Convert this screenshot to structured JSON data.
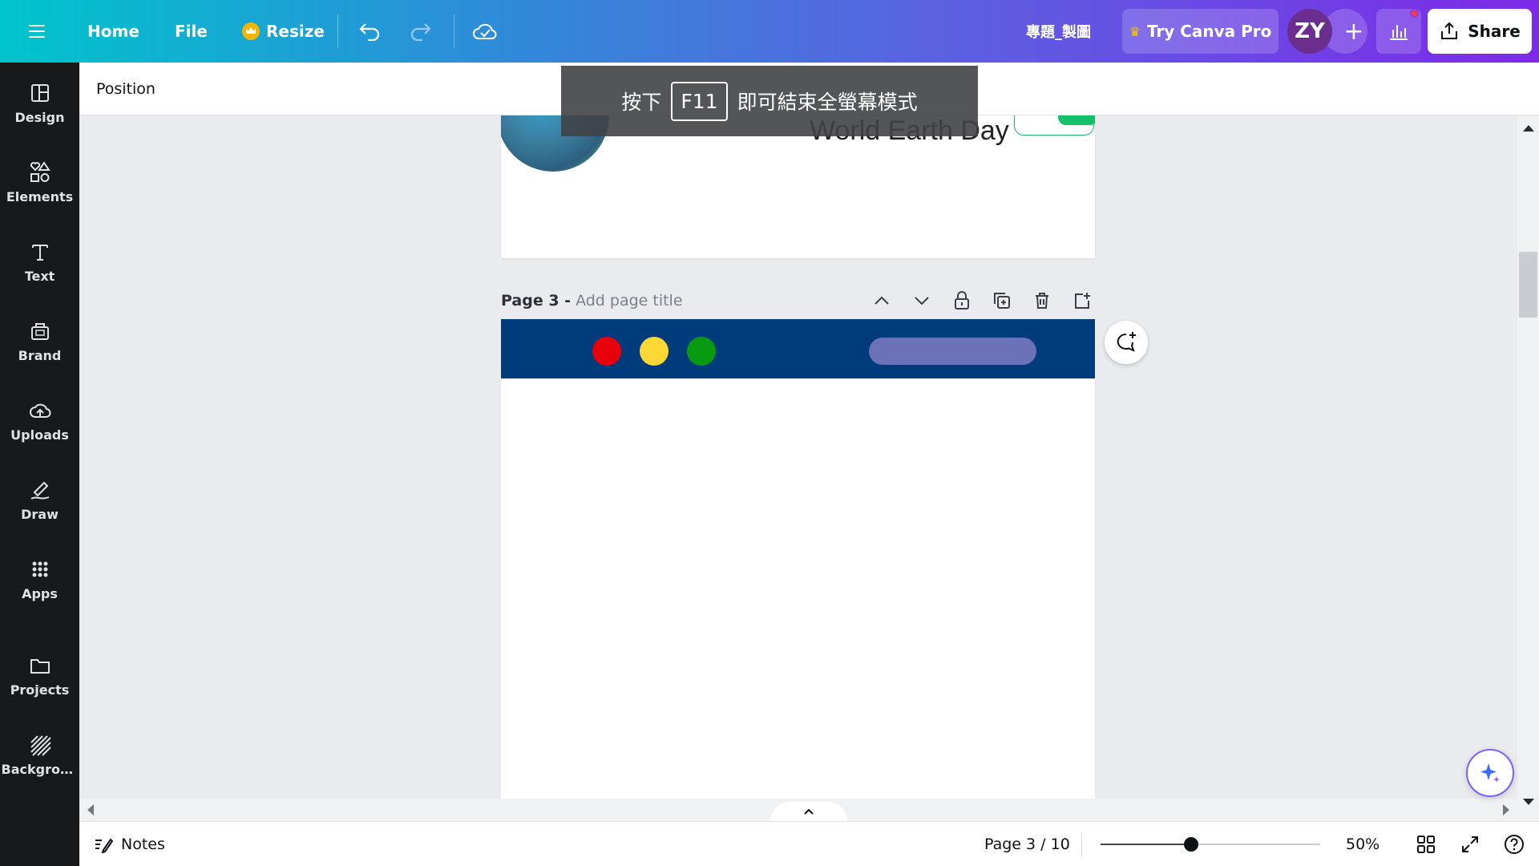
{
  "topbar": {
    "home_label": "Home",
    "file_label": "File",
    "resize_label": "Resize",
    "doc_title": "專題_製圖",
    "try_pro_label": "Try Canva Pro",
    "avatar_initials": "ZY",
    "share_label": "Share"
  },
  "sidebar": {
    "items": [
      {
        "label": "Design",
        "icon": "design-icon"
      },
      {
        "label": "Elements",
        "icon": "elements-icon"
      },
      {
        "label": "Text",
        "icon": "text-icon"
      },
      {
        "label": "Brand",
        "icon": "brand-icon"
      },
      {
        "label": "Uploads",
        "icon": "uploads-icon"
      },
      {
        "label": "Draw",
        "icon": "draw-icon"
      },
      {
        "label": "Apps",
        "icon": "apps-icon"
      },
      {
        "label": "Projects",
        "icon": "projects-icon"
      },
      {
        "label": "Backgrou..."
      }
    ]
  },
  "context_toolbar": {
    "position_label": "Position"
  },
  "toast": {
    "prefix": "按下",
    "key": "F11",
    "suffix": "即可結束全螢幕模式"
  },
  "canvas": {
    "prev_page_title": "World Earth Day",
    "page_number_label": "Page 3 -",
    "page_title_placeholder": "Add page title"
  },
  "colors": {
    "page3_header": "#003b7c",
    "dot_red": "#e8000b",
    "dot_yellow": "#fdd835",
    "dot_green": "#0a9a12",
    "pill": "#6b72b8"
  },
  "bottombar": {
    "notes_label": "Notes",
    "page_count": "Page 3 / 10",
    "zoom": "50%",
    "zoom_fraction": 0.41
  }
}
